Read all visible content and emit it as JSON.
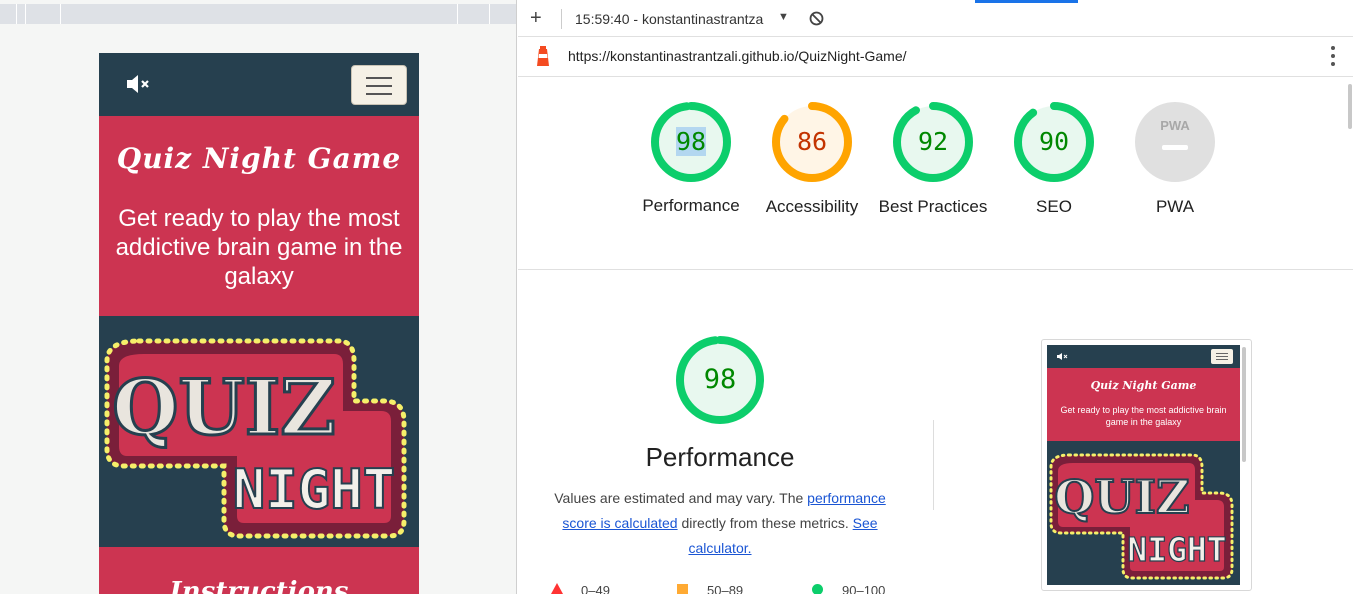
{
  "device_page": {
    "title": "Quiz Night Game",
    "subtitle": "Get ready to play the most addictive brain game in the galaxy",
    "logo_line1": "QUIZ",
    "logo_line2": "NIGHT",
    "next_section_title": "Instructions",
    "icons": {
      "mute": "volume-mute-icon",
      "menu": "hamburger-menu-icon"
    }
  },
  "toolbar": {
    "add_label": "+",
    "report_label": "15:59:40 - konstantinastrantza",
    "dropdown_label": "▼"
  },
  "url": "https://konstantinastrantzali.github.io/QuizNight-Game/",
  "scores": [
    {
      "label": "Performance",
      "value": "98",
      "status": "good"
    },
    {
      "label": "Accessibility",
      "value": "86",
      "status": "average"
    },
    {
      "label": "Best Practices",
      "value": "92",
      "status": "good"
    },
    {
      "label": "SEO",
      "value": "90",
      "status": "good"
    },
    {
      "label": "PWA",
      "value": "",
      "status": "na",
      "badge": "PWA"
    }
  ],
  "performance": {
    "score": "98",
    "title": "Performance",
    "desc_start": "Values are estimated and may vary. The ",
    "link1": "performance score is calculated",
    "desc_mid": " directly from these metrics. ",
    "link2": "See calculator."
  },
  "legend": [
    {
      "range": "0–49",
      "shape": "triangle",
      "color": "#ff3333"
    },
    {
      "range": "50–89",
      "shape": "square",
      "color": "#ffaa33"
    },
    {
      "range": "90–100",
      "shape": "circle",
      "color": "#0cce6b"
    }
  ],
  "thumbnail": {
    "title": "Quiz Night Game",
    "subtitle": "Get ready to play the most addictive brain game in the galaxy"
  },
  "colors": {
    "good": "#0cce6b",
    "good_text": "#008800",
    "average": "#ffa400",
    "average_text": "#c33300",
    "na": "#e0e0e0",
    "brand_red": "#cc3451",
    "brand_navy": "#26404f"
  }
}
